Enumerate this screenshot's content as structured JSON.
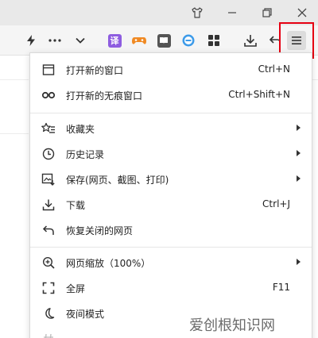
{
  "titlebar": {
    "buttons": [
      {
        "name": "tshirt-icon",
        "glyph": "👕"
      },
      {
        "name": "minimize-icon",
        "glyph": "—"
      },
      {
        "name": "restore-icon",
        "glyph": "❐"
      },
      {
        "name": "close-icon",
        "glyph": "✕"
      }
    ]
  },
  "toolbar": {
    "icons": [
      "lightning-icon",
      "more-icon",
      "chevron-down-icon",
      "translate-extension-icon",
      "game-extension-icon",
      "reader-extension-icon",
      "minus-circle-extension-icon",
      "apps-grid-icon",
      "download-icon",
      "undo-icon",
      "main-menu-icon"
    ],
    "ext_translate_label": "译"
  },
  "menu": {
    "items": [
      {
        "label": "打开新的窗口",
        "shortcut": "Ctrl+N",
        "icon": "new-window-icon"
      },
      {
        "label": "打开新的无痕窗口",
        "shortcut": "Ctrl+Shift+N",
        "icon": "incognito-icon"
      },
      {
        "label": "收藏夹",
        "shortcut": "",
        "icon": "bookmark-star-icon",
        "submenu": true
      },
      {
        "label": "历史记录",
        "shortcut": "",
        "icon": "history-clock-icon",
        "submenu": true
      },
      {
        "label": "保存(网页、截图、打印)",
        "shortcut": "",
        "icon": "save-image-icon",
        "submenu": true
      },
      {
        "label": "下载",
        "shortcut": "Ctrl+J",
        "icon": "download-icon"
      },
      {
        "label": "恢复关闭的网页",
        "shortcut": "",
        "icon": "restore-arrow-icon"
      },
      {
        "label": "网页缩放（100%）",
        "shortcut": "",
        "icon": "zoom-icon",
        "submenu": true
      },
      {
        "label": "全屏",
        "shortcut": "F11",
        "icon": "fullscreen-icon"
      },
      {
        "label": "夜间模式",
        "shortcut": "",
        "icon": "moon-icon"
      }
    ]
  },
  "watermark": {
    "text": "爱创根知识网"
  }
}
